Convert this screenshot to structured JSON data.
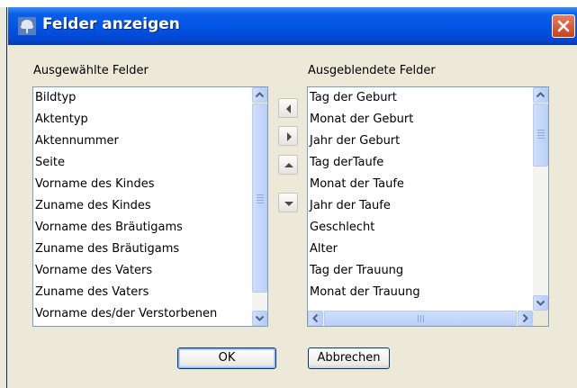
{
  "window": {
    "title": "Felder anzeigen",
    "close_label": "✕",
    "titlebar_color": "#0054E3"
  },
  "labels": {
    "selected": "Ausgewählte Felder",
    "hidden": "Ausgeblendete Felder"
  },
  "selected_fields": [
    "Bildtyp",
    "Aktentyp",
    "Aktennummer",
    "Seite",
    "Vorname des Kindes",
    "Zuname des Kindes",
    "Vorname des Bräutigams",
    "Zuname des Bräutigams",
    "Vorname des Vaters",
    "Zuname des Vaters",
    "Vorname des/der Verstorbenen"
  ],
  "hidden_fields": [
    "Tag der Geburt",
    "Monat der Geburt",
    "Jahr der Geburt",
    "Tag derTaufe",
    "Monat der Taufe",
    "Jahr der Taufe",
    "Geschlecht",
    "Alter",
    "Tag der Trauung",
    "Monat der Trauung"
  ],
  "move_buttons": [
    "move-left",
    "move-right",
    "move-up",
    "move-down"
  ],
  "buttons": {
    "ok": "OK",
    "cancel": "Abbrechen"
  }
}
